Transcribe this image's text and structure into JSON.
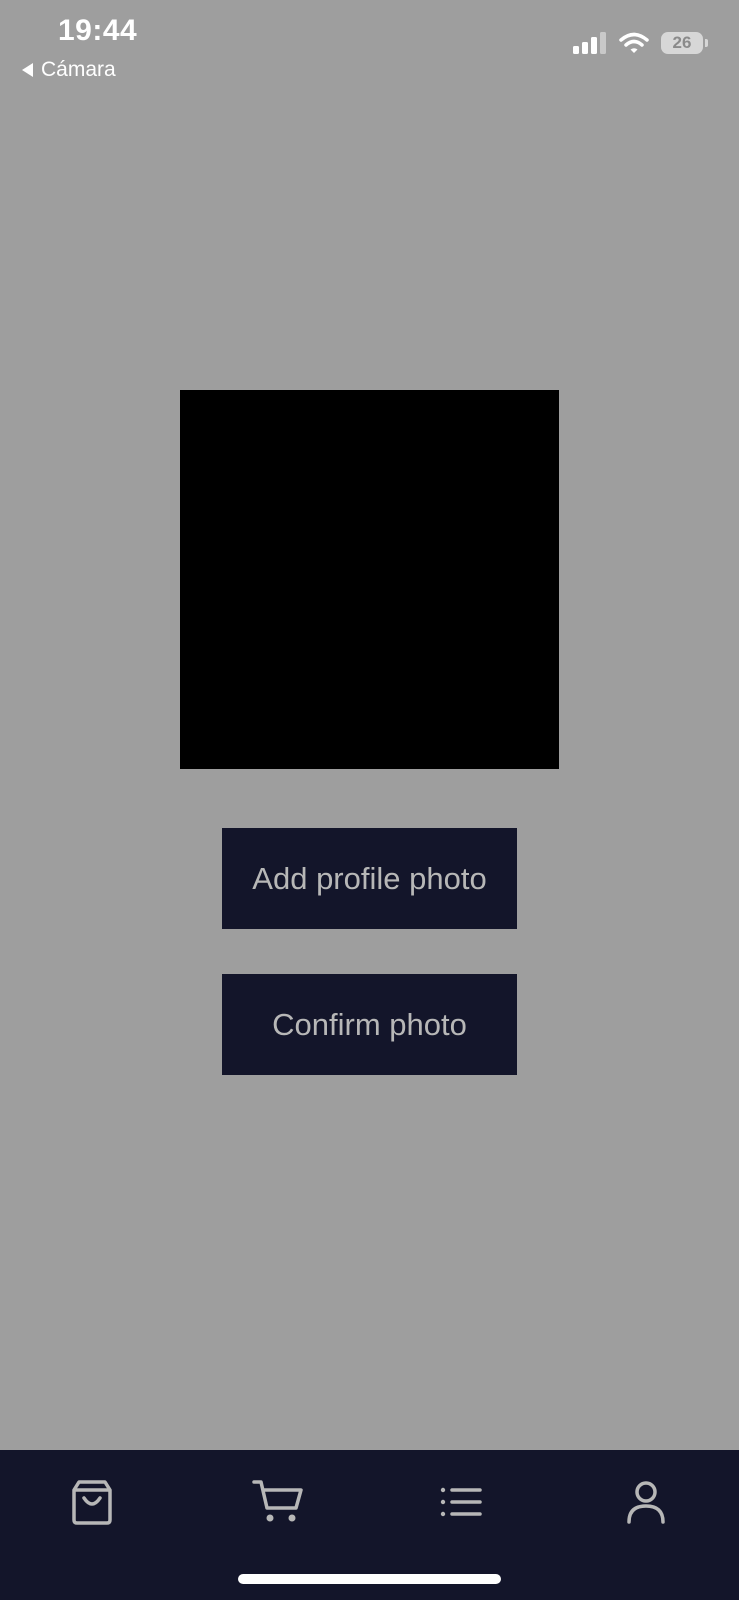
{
  "status_bar": {
    "time": "19:44",
    "back_app_label": "Cámara",
    "battery_level": "26",
    "icons": [
      "signal-icon",
      "wifi-icon",
      "battery-icon"
    ]
  },
  "photo_preview": {
    "background_color": "#000000"
  },
  "buttons": {
    "add_profile_photo": "Add profile photo",
    "confirm_photo": "Confirm photo"
  },
  "tab_bar": {
    "tabs": [
      {
        "icon": "shopping-bag-icon"
      },
      {
        "icon": "cart-icon"
      },
      {
        "icon": "list-icon"
      },
      {
        "icon": "user-icon"
      }
    ]
  },
  "colors": {
    "background": "#9e9e9e",
    "button_bg": "#13152a",
    "button_text": "#b7b7b7",
    "tabbar_bg": "#13152a",
    "icon_color": "#b7b7b7"
  }
}
